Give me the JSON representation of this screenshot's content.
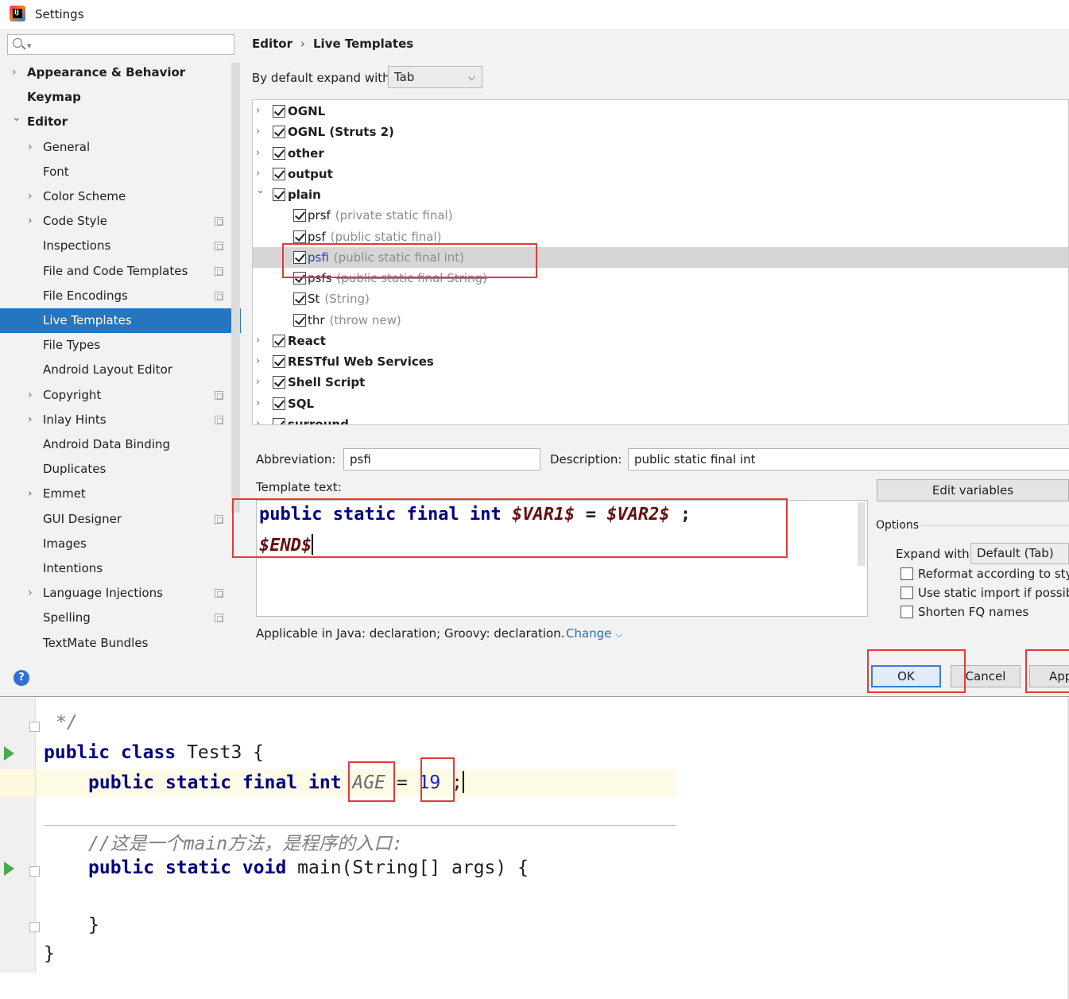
{
  "window": {
    "title": "Settings",
    "icon": "intellij-idea-icon"
  },
  "sidebar": {
    "search_placeholder": "",
    "items": [
      {
        "label": "Appearance & Behavior",
        "level": 0,
        "expandable": true,
        "expanded": false
      },
      {
        "label": "Keymap",
        "level": 0,
        "expandable": false
      },
      {
        "label": "Editor",
        "level": 0,
        "expandable": true,
        "expanded": true
      },
      {
        "label": "General",
        "level": 1,
        "expandable": true,
        "project_scope": false
      },
      {
        "label": "Font",
        "level": 1,
        "expandable": false,
        "project_scope": false
      },
      {
        "label": "Color Scheme",
        "level": 1,
        "expandable": true,
        "project_scope": false
      },
      {
        "label": "Code Style",
        "level": 1,
        "expandable": true,
        "project_scope": true
      },
      {
        "label": "Inspections",
        "level": 1,
        "expandable": false,
        "project_scope": true
      },
      {
        "label": "File and Code Templates",
        "level": 1,
        "expandable": false,
        "project_scope": true
      },
      {
        "label": "File Encodings",
        "level": 1,
        "expandable": false,
        "project_scope": true
      },
      {
        "label": "Live Templates",
        "level": 1,
        "expandable": false,
        "selected": true
      },
      {
        "label": "File Types",
        "level": 1,
        "expandable": false
      },
      {
        "label": "Android Layout Editor",
        "level": 1,
        "expandable": false
      },
      {
        "label": "Copyright",
        "level": 1,
        "expandable": true,
        "project_scope": true
      },
      {
        "label": "Inlay Hints",
        "level": 1,
        "expandable": true,
        "project_scope": true
      },
      {
        "label": "Android Data Binding",
        "level": 1,
        "expandable": false
      },
      {
        "label": "Duplicates",
        "level": 1,
        "expandable": false
      },
      {
        "label": "Emmet",
        "level": 1,
        "expandable": true
      },
      {
        "label": "GUI Designer",
        "level": 1,
        "expandable": false,
        "project_scope": true
      },
      {
        "label": "Images",
        "level": 1,
        "expandable": false
      },
      {
        "label": "Intentions",
        "level": 1,
        "expandable": false
      },
      {
        "label": "Language Injections",
        "level": 1,
        "expandable": true,
        "project_scope": true
      },
      {
        "label": "Spelling",
        "level": 1,
        "expandable": false,
        "project_scope": true
      },
      {
        "label": "TextMate Bundles",
        "level": 1,
        "expandable": false
      }
    ]
  },
  "breadcrumb": {
    "parent": "Editor",
    "separator": "›",
    "current": "Live Templates"
  },
  "expand_default": {
    "label": "By default expand with",
    "value": "Tab"
  },
  "templates": [
    {
      "type": "group",
      "name": "OGNL",
      "checked": true,
      "expanded": false
    },
    {
      "type": "group",
      "name": "OGNL (Struts 2)",
      "checked": true,
      "expanded": false
    },
    {
      "type": "group",
      "name": "other",
      "checked": true,
      "expanded": false
    },
    {
      "type": "group",
      "name": "output",
      "checked": true,
      "expanded": false
    },
    {
      "type": "group",
      "name": "plain",
      "checked": true,
      "expanded": true
    },
    {
      "type": "child",
      "abbr": "prsf",
      "desc": "(private static final)",
      "checked": true
    },
    {
      "type": "child",
      "abbr": "psf",
      "desc": "(public static final)",
      "checked": true
    },
    {
      "type": "child",
      "abbr": "psfi",
      "desc": "(public static final int)",
      "checked": true,
      "selected": true
    },
    {
      "type": "child",
      "abbr": "psfs",
      "desc": "(public static final String)",
      "checked": true,
      "struck": true
    },
    {
      "type": "child",
      "abbr": "St",
      "desc": "(String)",
      "checked": true
    },
    {
      "type": "child",
      "abbr": "thr",
      "desc": "(throw new)",
      "checked": true
    },
    {
      "type": "group",
      "name": "React",
      "checked": true,
      "expanded": false
    },
    {
      "type": "group",
      "name": "RESTful Web Services",
      "checked": true,
      "expanded": false
    },
    {
      "type": "group",
      "name": "Shell Script",
      "checked": true,
      "expanded": false
    },
    {
      "type": "group",
      "name": "SQL",
      "checked": true,
      "expanded": false
    },
    {
      "type": "group",
      "name": "surround",
      "checked": true,
      "expanded": false
    }
  ],
  "form": {
    "abbreviation_label": "Abbreviation:",
    "abbreviation_value": "psfi",
    "description_label": "Description:",
    "description_value": "public static final int",
    "template_text_label": "Template text:",
    "template_line1": {
      "kw1": "public",
      "kw2": "static",
      "kw3": "final",
      "kw4": "int",
      "var1": "$VAR1$",
      "eq": "=",
      "var2": "$VAR2$",
      "semi": ";"
    },
    "template_line2": "$END$",
    "edit_variables": "Edit variables",
    "options_label": "Options",
    "expand_with_label": "Expand with",
    "expand_with_value": "Default (Tab)",
    "options": [
      {
        "label": "Reformat according to sty",
        "checked": false
      },
      {
        "label": "Use static import if possib",
        "checked": false
      },
      {
        "label": "Shorten FQ names",
        "checked": false
      }
    ],
    "applicable_text": "Applicable in Java: declaration; Groovy: declaration.",
    "change_link": "Change"
  },
  "buttons": {
    "help": "?",
    "ok": "OK",
    "cancel": "Cancel",
    "apply": "App"
  },
  "editor": {
    "comment_end": "*/",
    "class_decl": {
      "kw1": "public",
      "kw2": "class",
      "name": "Test3",
      "brace": "{"
    },
    "field_decl": {
      "kw1": "public",
      "kw2": "static",
      "kw3": "final",
      "kw4": "int",
      "name": "AGE",
      "eq": "=",
      "value": "19",
      "semi": ";"
    },
    "comment_line": "//这是一个main方法，是程序的入口:",
    "main_decl": {
      "kw1": "public",
      "kw2": "static",
      "kw3": "void",
      "rest": "main(String[] args) {"
    },
    "close_method": "}",
    "close_class": "}"
  },
  "colors": {
    "selection": "#2675bf",
    "keyword": "#000080",
    "template_var": "#660e0e",
    "number": "#1a22d8",
    "highlight_box": "#e23a3a",
    "link": "#2470b3"
  }
}
